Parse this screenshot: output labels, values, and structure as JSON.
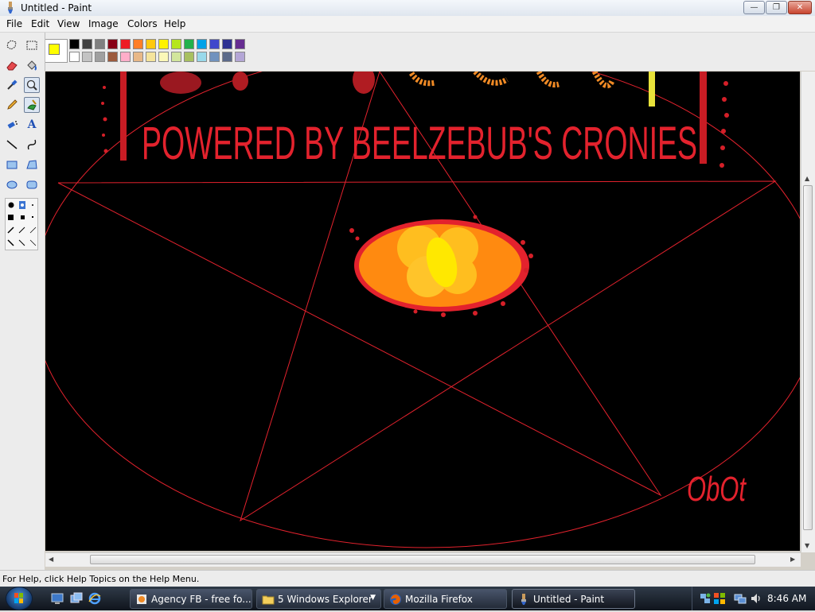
{
  "window": {
    "title": "Untitled - Paint",
    "buttons": {
      "minimize": "—",
      "maximize": "❐",
      "close": "✕"
    }
  },
  "menu": {
    "items": [
      {
        "label": "File"
      },
      {
        "label": "Edit"
      },
      {
        "label": "View"
      },
      {
        "label": "Image"
      },
      {
        "label": "Colors"
      },
      {
        "label": "Help"
      }
    ]
  },
  "colors": {
    "foreground": "#ffff00",
    "background": "#ffffff",
    "palette_top": [
      "#000000",
      "#404040",
      "#808080",
      "#880015",
      "#ed1c24",
      "#ff7f27",
      "#ffc90e",
      "#fff200",
      "#b5e61d",
      "#22b14c",
      "#00a2e8",
      "#3f48cc",
      "#2e3192",
      "#662d91"
    ],
    "palette_bottom": [
      "#ffffff",
      "#c3c3c3",
      "#a0a0a0",
      "#9c5a3c",
      "#ffaec9",
      "#e8b887",
      "#f5e49c",
      "#fbf8b8",
      "#d2e69c",
      "#a8c060",
      "#99d9ea",
      "#7092be",
      "#5b6a8a",
      "#b4a6d6"
    ]
  },
  "tools": [
    {
      "name": "free-form-select-icon",
      "active": false
    },
    {
      "name": "select-icon",
      "active": false
    },
    {
      "name": "eraser-icon",
      "active": false
    },
    {
      "name": "fill-with-color-icon",
      "active": false
    },
    {
      "name": "pick-color-icon",
      "active": false
    },
    {
      "name": "magnifier-icon",
      "active": true
    },
    {
      "name": "pencil-icon",
      "active": false
    },
    {
      "name": "brush-icon",
      "active": false
    },
    {
      "name": "airbrush-icon",
      "active": false
    },
    {
      "name": "text-icon",
      "active": false
    },
    {
      "name": "line-icon",
      "active": false
    },
    {
      "name": "curve-icon",
      "active": false
    },
    {
      "name": "rectangle-icon",
      "active": false
    },
    {
      "name": "polygon-icon",
      "active": false
    },
    {
      "name": "ellipse-icon",
      "active": false
    },
    {
      "name": "rounded-rectangle-icon",
      "active": false
    }
  ],
  "text_tool_glyph": "A",
  "canvas": {
    "banner_text": "POWERED BY BEELZEBUB'S CRONIES",
    "signature": "ObOt",
    "accent_color": "#e3222d"
  },
  "status": {
    "help_text": "For Help, click Help Topics on the Help Menu."
  },
  "taskbar": {
    "quick_launch": [
      "show-desktop-icon",
      "switch-windows-icon",
      "internet-explorer-icon"
    ],
    "tasks": [
      {
        "label": "Agency FB - free fo...",
        "icon": "browser-page-icon",
        "active": false
      },
      {
        "label": "5 Windows Explorer",
        "icon": "folder-icon",
        "active": false
      },
      {
        "label": "Mozilla Firefox",
        "icon": "firefox-icon",
        "active": false
      },
      {
        "label": "Untitled - Paint",
        "icon": "paint-icon",
        "active": true
      }
    ],
    "time": "8:46 AM"
  }
}
